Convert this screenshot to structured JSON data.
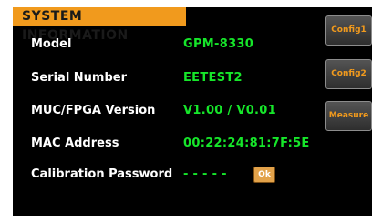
{
  "header": {
    "title": "SYSTEM INFORMATION"
  },
  "info": [
    {
      "label": "Model",
      "value": "GPM-8330"
    },
    {
      "label": "Serial Number",
      "value": "EETEST2"
    },
    {
      "label": "MUC/FPGA Version",
      "value": "V1.00 / V0.01"
    },
    {
      "label": "MAC Address",
      "value": "00:22:24:81:7F:5E"
    },
    {
      "label": "Calibration Password",
      "value": "- - - - -"
    }
  ],
  "ok_button": {
    "label": "Ok"
  },
  "side_menu": [
    {
      "label": "Config1"
    },
    {
      "label": "Config2"
    },
    {
      "label": "Measure"
    }
  ],
  "colors": {
    "accent": "#f19a1d",
    "value_text": "#16e62a",
    "background": "#000000"
  }
}
